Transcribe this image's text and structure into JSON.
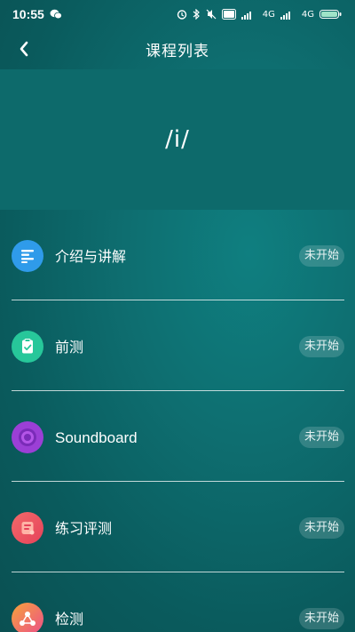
{
  "status_bar": {
    "time": "10:55",
    "signal_1": "4G",
    "signal_2": "4G",
    "battery_label": "99"
  },
  "nav": {
    "title": "课程列表"
  },
  "banner": {
    "phoneme": "/i/"
  },
  "lessons": [
    {
      "label": "介绍与讲解",
      "status": "未开始",
      "icon": "list-icon",
      "color": "#2f9bea"
    },
    {
      "label": "前测",
      "status": "未开始",
      "icon": "clipboard-check-icon",
      "color": "#27c79a"
    },
    {
      "label": "Soundboard",
      "status": "未开始",
      "icon": "disc-icon",
      "color": "#9b3fd6"
    },
    {
      "label": "练习评测",
      "status": "未开始",
      "icon": "notebook-icon",
      "color": "#f0545a"
    },
    {
      "label": "检测",
      "status": "未开始",
      "icon": "network-icon",
      "color": "#f26a3a"
    }
  ]
}
